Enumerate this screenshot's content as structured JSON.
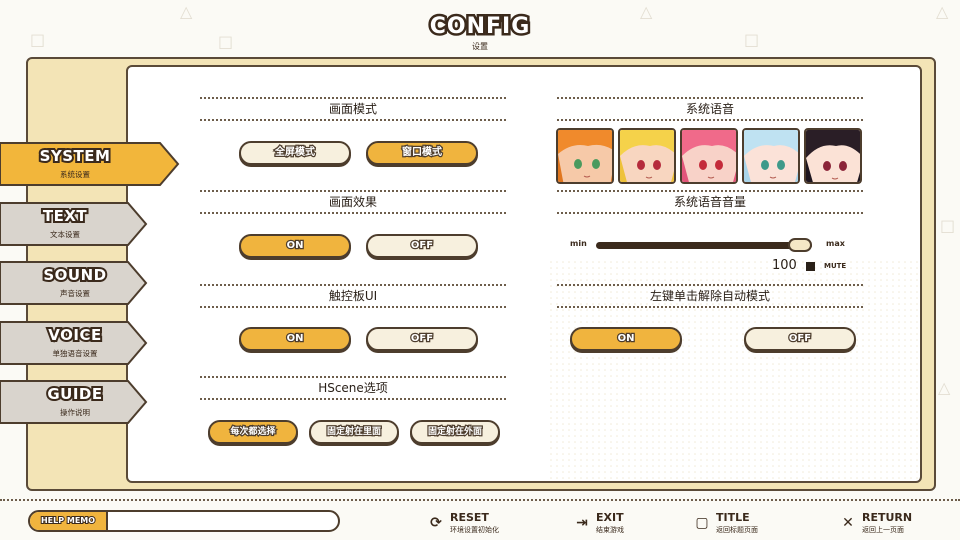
{
  "header": {
    "title": "CONFIG",
    "subtitle": "设置"
  },
  "sidebar": {
    "items": [
      {
        "label": "SYSTEM",
        "sub": "系统设置",
        "active": true
      },
      {
        "label": "TEXT",
        "sub": "文本设置",
        "active": false
      },
      {
        "label": "SOUND",
        "sub": "声音设置",
        "active": false
      },
      {
        "label": "VOICE",
        "sub": "单独语音设置",
        "active": false
      },
      {
        "label": "GUIDE",
        "sub": "操作说明",
        "active": false
      }
    ]
  },
  "left": {
    "screen_mode": {
      "title": "画面模式",
      "options": [
        "全屏模式",
        "窗口模式"
      ],
      "selected": "窗口模式"
    },
    "screen_effect": {
      "title": "画面效果",
      "options": [
        "ON",
        "OFF"
      ],
      "selected": "ON"
    },
    "touchpad_ui": {
      "title": "触控板UI",
      "options": [
        "ON",
        "OFF"
      ],
      "selected": "ON"
    },
    "hscene": {
      "title": "HScene选项",
      "options": [
        "每次都选择",
        "固定射在里面",
        "固定射在外面"
      ],
      "selected": "每次都选择"
    }
  },
  "right": {
    "system_voice": {
      "title": "系统语音",
      "characters": 5
    },
    "system_voice_volume": {
      "title": "系统语音音量",
      "min_label": "min",
      "max_label": "max",
      "value": 100,
      "value_text": "100",
      "mute_label": "MUTE"
    },
    "left_click_auto": {
      "title": "左键单击解除自动模式",
      "options": [
        "ON",
        "OFF"
      ],
      "selected": "ON"
    }
  },
  "footer": {
    "help_memo_label": "HELP MEMO",
    "help_memo_text": "",
    "buttons": [
      {
        "label": "RESET",
        "sub": "环境设置初始化",
        "icon": "refresh-icon"
      },
      {
        "label": "EXIT",
        "sub": "结束游戏",
        "icon": "exit-icon"
      },
      {
        "label": "TITLE",
        "sub": "返回标题页面",
        "icon": "title-icon"
      },
      {
        "label": "RETURN",
        "sub": "返回上一页面",
        "icon": "close-icon"
      }
    ]
  },
  "colors": {
    "accent": "#f0b43e",
    "off": "#f7f0de",
    "outline": "#4d3d2d",
    "frame": "#f3e4b6",
    "tab_inactive": "#d7d2cb"
  }
}
